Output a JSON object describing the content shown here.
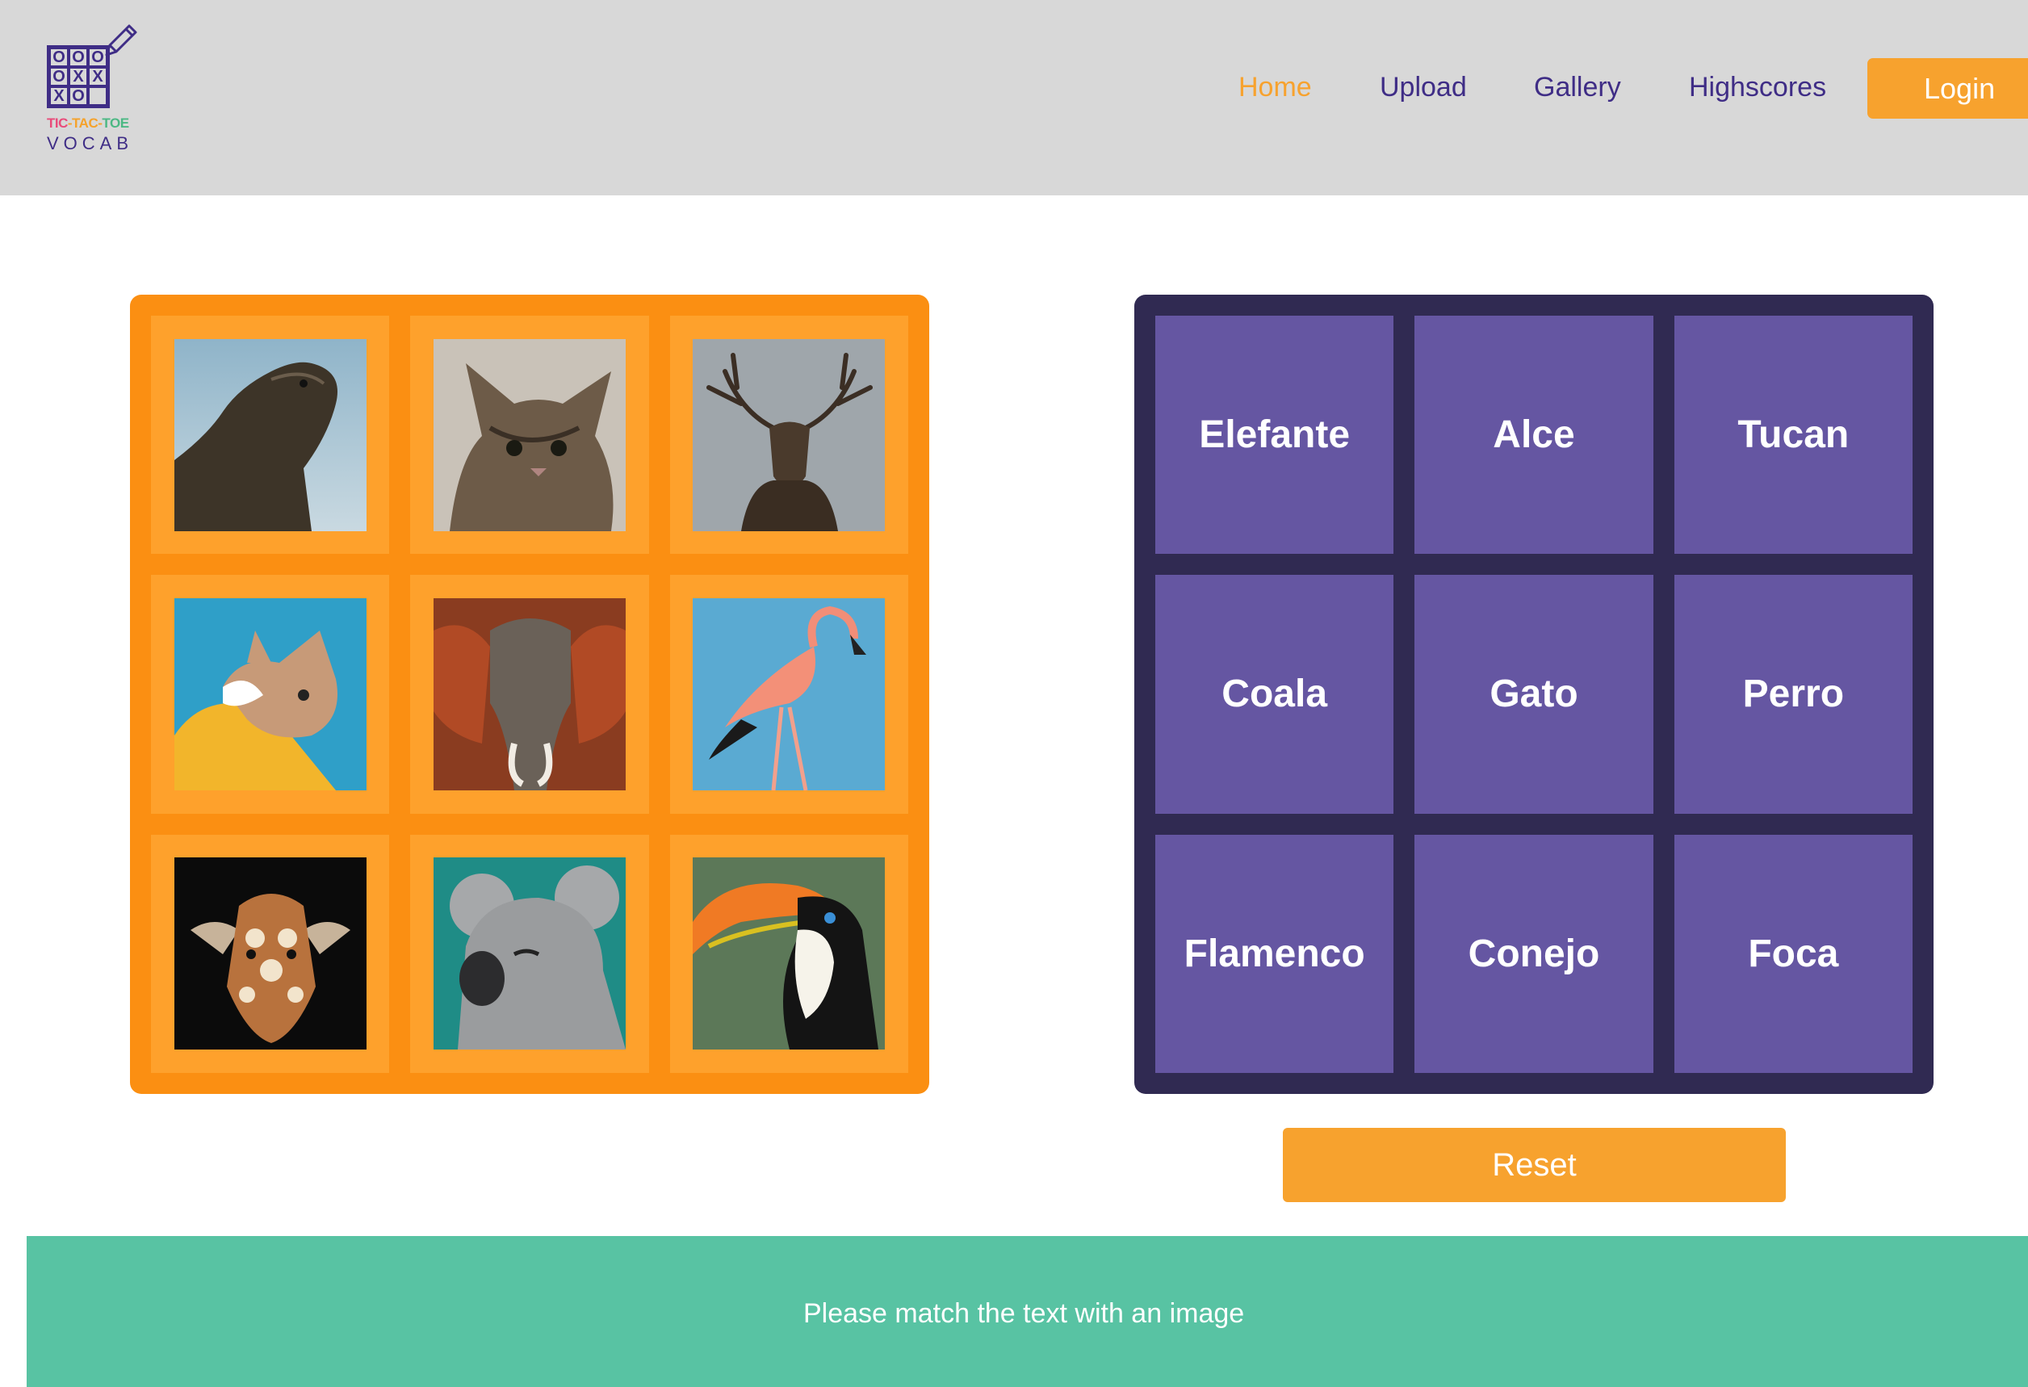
{
  "logo": {
    "line1": [
      "TIC",
      "-TAC-",
      "TOE"
    ],
    "line2": "VOCAB",
    "grid_marks": [
      "O",
      "O",
      "O",
      "O",
      "X",
      "X",
      "X",
      "O",
      ""
    ],
    "icon": "pencil-icon"
  },
  "nav": {
    "items": [
      "Home",
      "Upload",
      "Gallery",
      "Highscores"
    ],
    "active": "Home",
    "login_label": "Login"
  },
  "image_board": {
    "tiles": [
      {
        "icon": "sea-lion-photo"
      },
      {
        "icon": "kitten-photo"
      },
      {
        "icon": "deer-photo"
      },
      {
        "icon": "french-bulldog-photo"
      },
      {
        "icon": "elephant-photo"
      },
      {
        "icon": "flamingo-photo"
      },
      {
        "icon": "giraffe-photo"
      },
      {
        "icon": "koala-photo"
      },
      {
        "icon": "toucan-photo"
      }
    ]
  },
  "word_board": {
    "words": [
      "Elefante",
      "Alce",
      "Tucan",
      "Coala",
      "Gato",
      "Perro",
      "Flamenco",
      "Conejo",
      "Foca"
    ]
  },
  "reset_label": "Reset",
  "footer": {
    "message": "Please match the text with an image"
  },
  "colors": {
    "header_bg": "#d8d8d8",
    "accent_orange": "#f7a22e",
    "nav_text": "#3f2d86",
    "image_board_bg": "#fb8f12",
    "word_board_bg": "#302a52",
    "word_tile": "#6556a2",
    "footer_bg": "#58c3a3"
  }
}
